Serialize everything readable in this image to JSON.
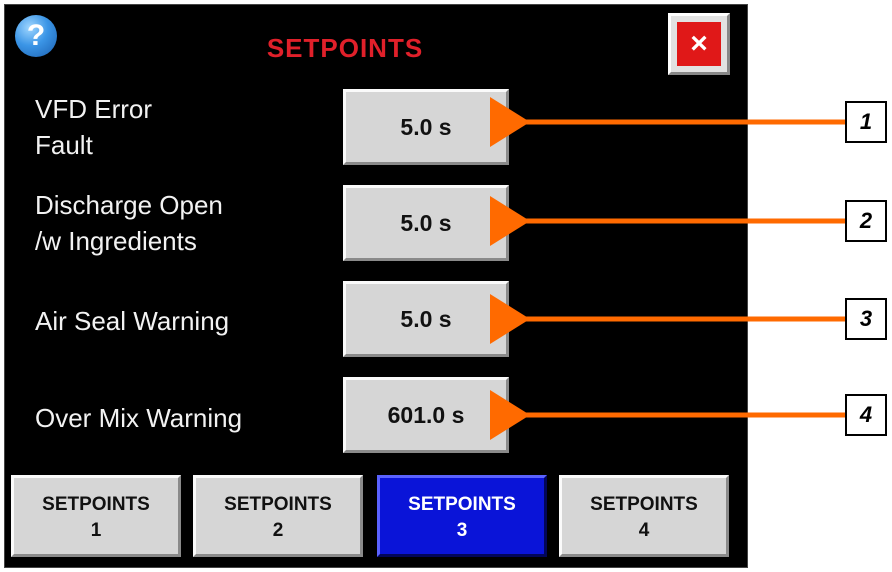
{
  "header": {
    "help_symbol": "?",
    "title": "SETPOINTS",
    "close_symbol": "×"
  },
  "setpoints": [
    {
      "label_line1": "VFD Error",
      "label_line2": "Fault",
      "value": "5.0 s"
    },
    {
      "label_line1": "Discharge Open",
      "label_line2": "/w Ingredients",
      "value": "5.0 s"
    },
    {
      "label_line1": "Air Seal Warning",
      "label_line2": "",
      "value": "5.0 s"
    },
    {
      "label_line1": "Over Mix Warning",
      "label_line2": "",
      "value": "601.0 s"
    }
  ],
  "tabs": [
    {
      "line1": "SETPOINTS",
      "line2": "1",
      "active": false
    },
    {
      "line1": "SETPOINTS",
      "line2": "2",
      "active": false
    },
    {
      "line1": "SETPOINTS",
      "line2": "3",
      "active": true
    },
    {
      "line1": "SETPOINTS",
      "line2": "4",
      "active": false
    }
  ],
  "callouts": [
    "1",
    "2",
    "3",
    "4"
  ],
  "colors": {
    "title": "#e0202a",
    "active_tab": "#0a14d8",
    "arrow": "#ff6a00",
    "close": "#e01818"
  }
}
